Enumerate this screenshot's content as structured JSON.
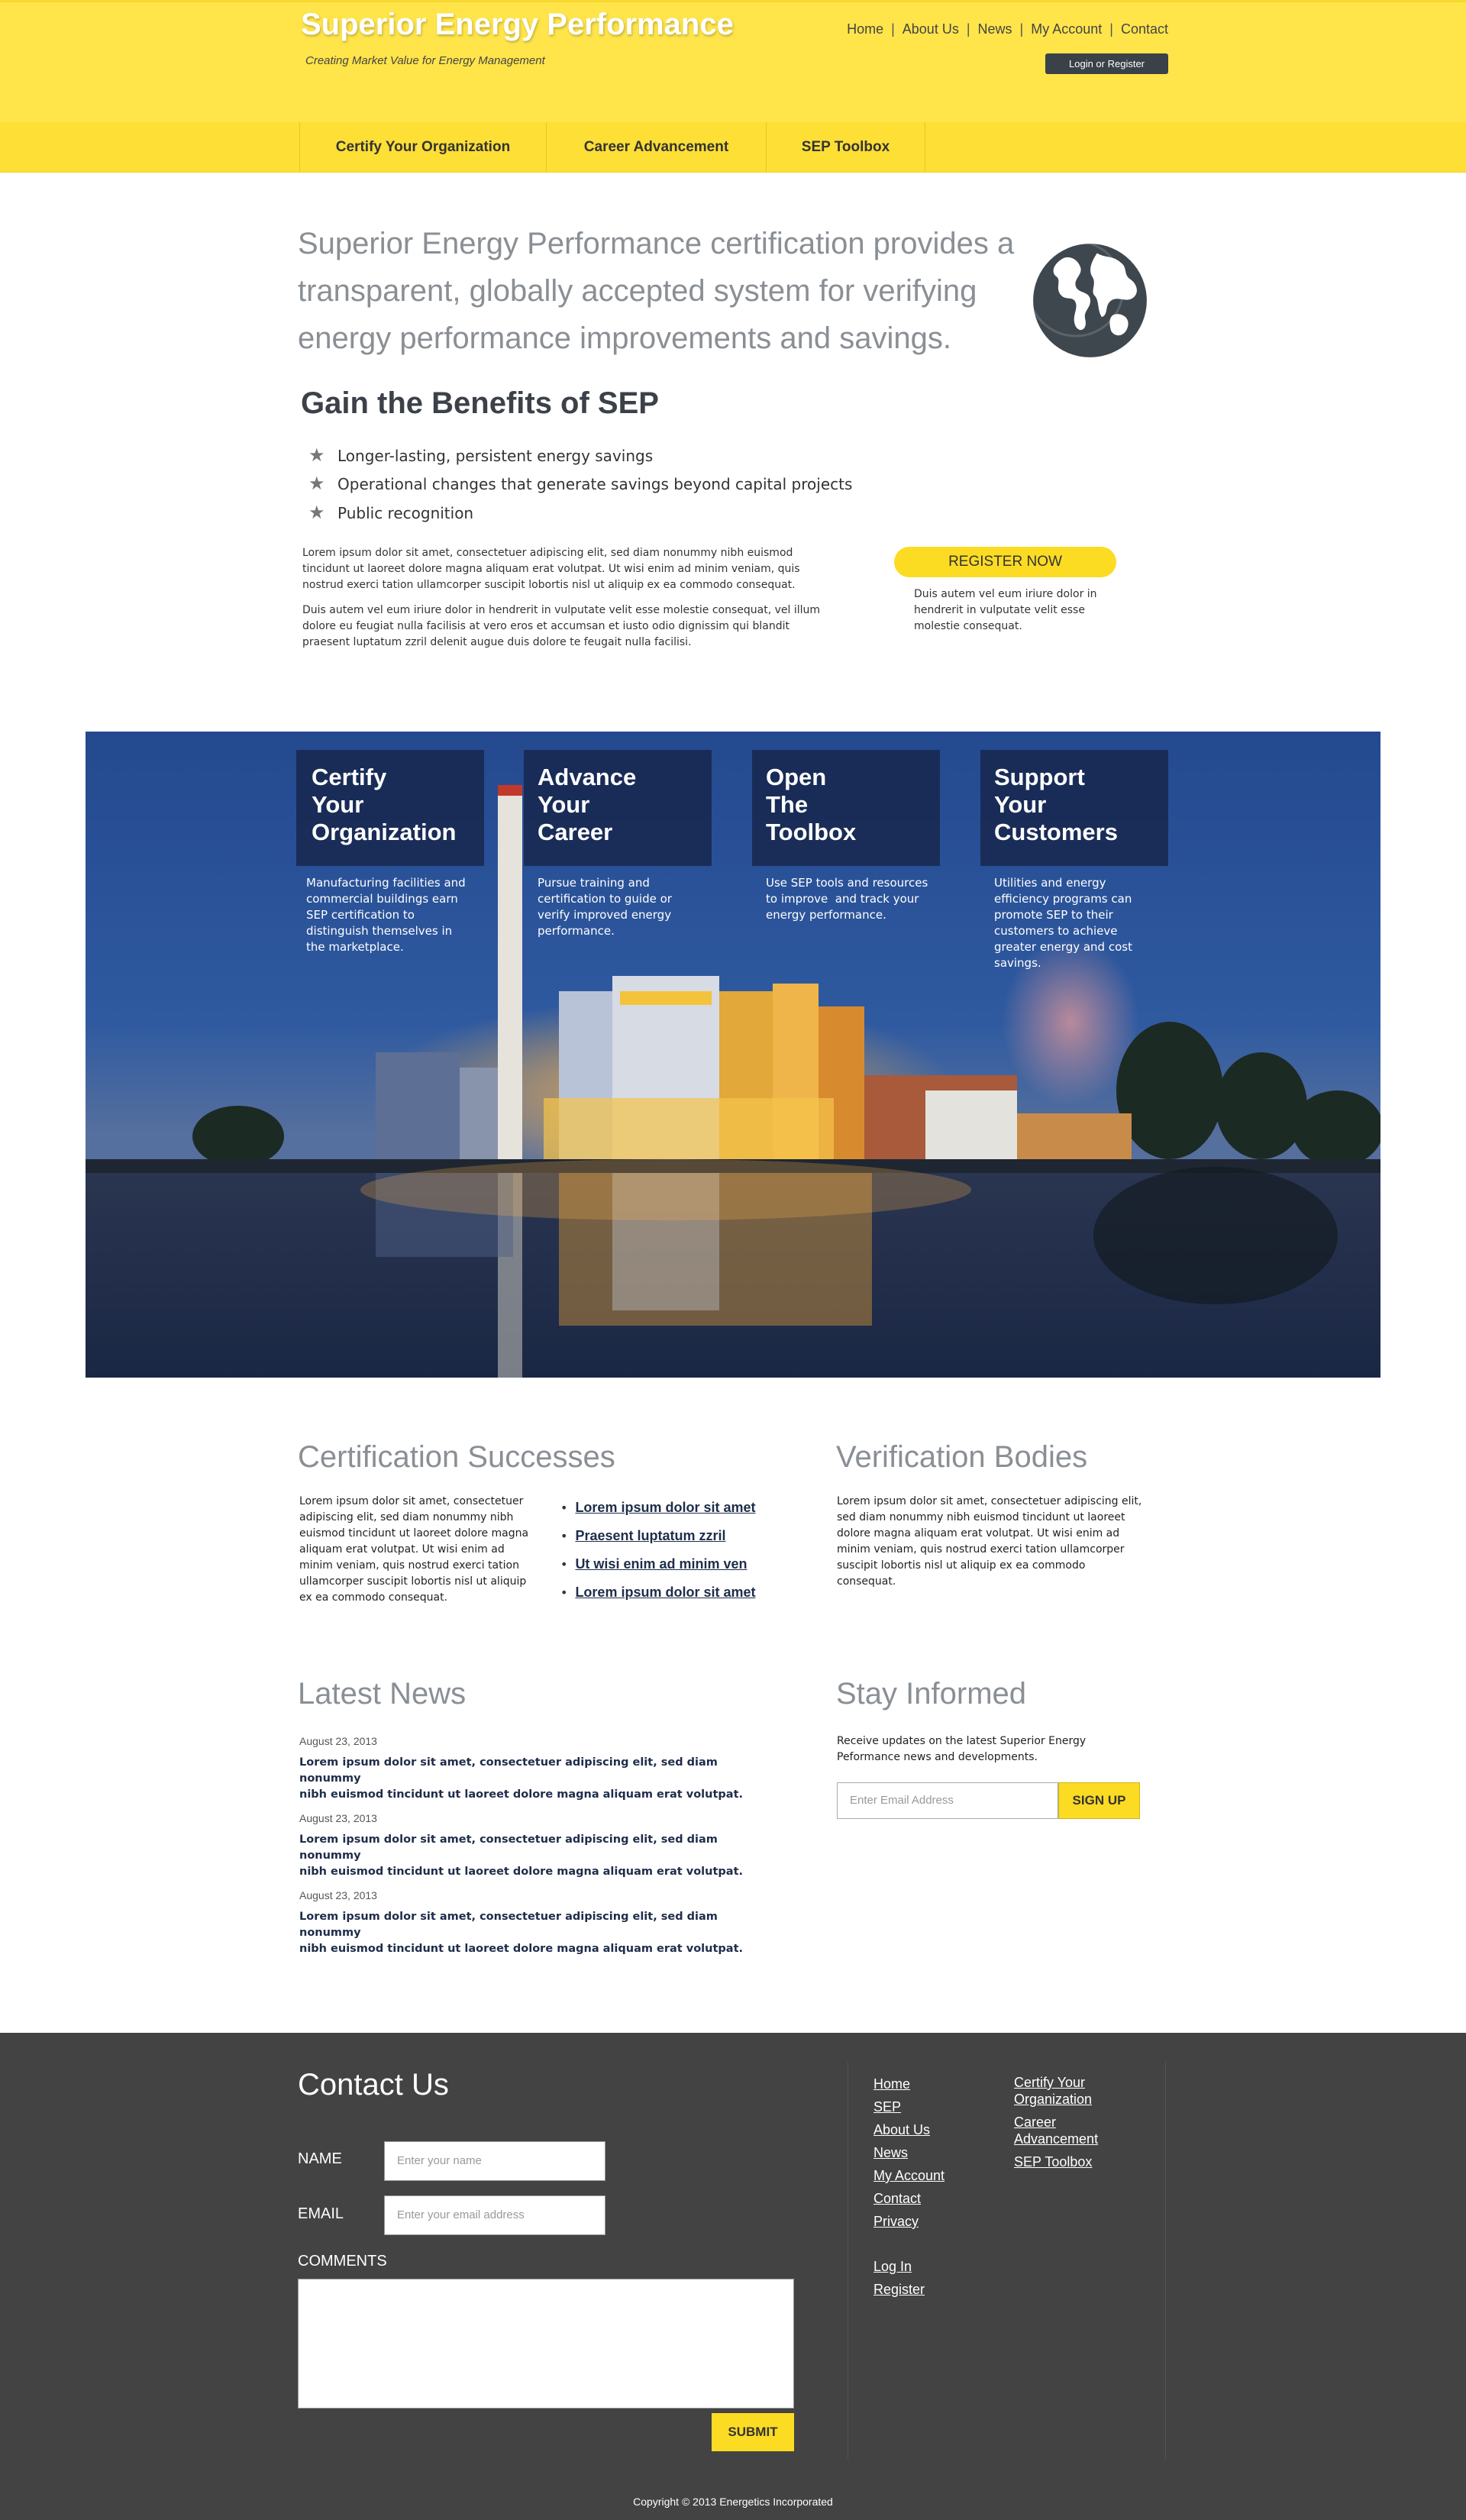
{
  "header": {
    "logo": "Superior Energy Performance",
    "tagline": "Creating Market Value for Energy Management",
    "topnav": [
      "Home",
      "About Us",
      "News",
      "My Account",
      "Contact"
    ],
    "login_label": "Login or Register"
  },
  "mainnav": [
    "Certify Your Organization",
    "Career Advancement",
    "SEP Toolbox"
  ],
  "intro": {
    "line1": "Superior Energy Performance certification provides a",
    "line2": "transparent, globally accepted system for verifying",
    "line3": "energy performance improvements and savings."
  },
  "benefits": {
    "title": "Gain the Benefits of SEP",
    "items": [
      "Longer-lasting, persistent energy savings",
      "Operational changes that generate savings beyond capital projects",
      "Public recognition"
    ],
    "para1_l1": "Lorem ipsum dolor sit amet, consectetuer adipiscing elit, sed diam nonummy nibh euismod",
    "para1_l2": "tincidunt ut laoreet dolore magna aliquam erat volutpat. Ut wisi enim ad minim veniam, quis",
    "para1_l3": "nostrud exerci tation ullamcorper suscipit lobortis nisl ut aliquip ex ea commodo consequat.",
    "para2_l1": "Duis autem vel eum iriure dolor in hendrerit in vulputate velit esse molestie consequat, vel illum",
    "para2_l2": "dolore eu feugiat nulla facilisis at vero eros et accumsan et iusto odio dignissim qui blandit",
    "para2_l3": "praesent luptatum zzril delenit augue duis dolore te feugait nulla facilisi.",
    "register_label": "REGISTER NOW",
    "register_note_l1": "Duis autem vel eum iriure dolor in",
    "register_note_l2": "hendrerit in vulputate velit esse",
    "register_note_l3": "molestie consequat."
  },
  "cards": [
    {
      "t1": "Certify",
      "t2": "Your",
      "t3": "Organization",
      "lines": [
        "Manufacturing facilities and",
        "commercial buildings earn",
        "SEP certification to",
        "distinguish themselves in",
        "the marketplace."
      ]
    },
    {
      "t1": "Advance",
      "t2": "Your",
      "t3": "Career",
      "lines": [
        "Pursue training and",
        "certification to guide or",
        "verify improved energy",
        "performance."
      ]
    },
    {
      "t1": "Open",
      "t2": "The",
      "t3": "Toolbox",
      "lines": [
        "Use SEP tools and resources",
        "to improve  and track your",
        "energy performance."
      ]
    },
    {
      "t1": "Support",
      "t2": "Your",
      "t3": "Customers",
      "lines": [
        "Utilities and energy",
        "efficiency programs can",
        "promote SEP to their",
        "customers to achieve",
        "greater energy and cost",
        "savings."
      ]
    }
  ],
  "certification": {
    "title": "Certification Successes",
    "lines": [
      "Lorem ipsum dolor sit amet, consectetuer",
      "adipiscing elit, sed diam nonummy nibh",
      "euismod tincidunt ut laoreet dolore magna",
      "aliquam erat volutpat. Ut wisi enim ad",
      "minim veniam, quis nostrud exerci tation",
      "ullamcorper suscipit lobortis nisl ut aliquip",
      "ex ea commodo consequat."
    ],
    "links": [
      "Lorem ipsum dolor sit amet",
      "Praesent luptatum zzril",
      "Ut wisi enim ad minim ven",
      "Lorem ipsum dolor sit amet"
    ]
  },
  "verification": {
    "title": "Verification Bodies",
    "lines": [
      "Lorem ipsum dolor sit amet, consectetuer adipiscing elit,",
      "sed diam nonummy nibh euismod tincidunt ut laoreet",
      "dolore magna aliquam erat volutpat. Ut wisi enim ad",
      "minim veniam, quis nostrud exerci tation ullamcorper",
      "suscipit lobortis nisl ut aliquip ex ea commodo",
      "consequat."
    ]
  },
  "news": {
    "title": "Latest News",
    "items": [
      {
        "date": "August 23, 2013",
        "l1": "Lorem ipsum dolor sit amet, consectetuer adipiscing elit, sed diam nonummy",
        "l2": "nibh euismod tincidunt ut laoreet dolore magna aliquam erat volutpat."
      },
      {
        "date": "August 23, 2013",
        "l1": "Lorem ipsum dolor sit amet, consectetuer adipiscing elit, sed diam nonummy",
        "l2": "nibh euismod tincidunt ut laoreet dolore magna aliquam erat volutpat."
      },
      {
        "date": "August 23, 2013",
        "l1": "Lorem ipsum dolor sit amet, consectetuer adipiscing elit, sed diam nonummy",
        "l2": "nibh euismod tincidunt ut laoreet dolore magna aliquam erat volutpat."
      }
    ]
  },
  "stay": {
    "title": "Stay Informed",
    "l1": "Receive updates on the latest Superior Energy",
    "l2": "Peformance news and developments.",
    "email_placeholder": "Enter Email Address",
    "signup_label": "SIGN UP"
  },
  "footer": {
    "contact_title": "Contact Us",
    "name_label": "NAME",
    "name_placeholder": "Enter your name",
    "email_label": "EMAIL",
    "email_placeholder": "Enter your email address",
    "comments_label": "COMMENTS",
    "submit_label": "SUBMIT",
    "links1": [
      "Home",
      "SEP",
      "About Us",
      "News",
      "My Account",
      "Contact",
      "Privacy"
    ],
    "links_account": [
      "Log In",
      "Register"
    ],
    "links2": [
      {
        "l1": "Certify Your",
        "l2": "Organization"
      },
      {
        "l1": "Career",
        "l2": "Advancement"
      },
      {
        "l1": "SEP Toolbox",
        "l2": ""
      }
    ],
    "copyright": "Copyright © 2013 Energetics Incorporated"
  },
  "colors": {
    "accent_yellow": "#fcdb23",
    "header_yellow": "#ffe54a",
    "dark_footer": "#434343",
    "card_blue": "#182850"
  },
  "icons": {
    "globe": "globe-icon",
    "star": "star-icon"
  }
}
